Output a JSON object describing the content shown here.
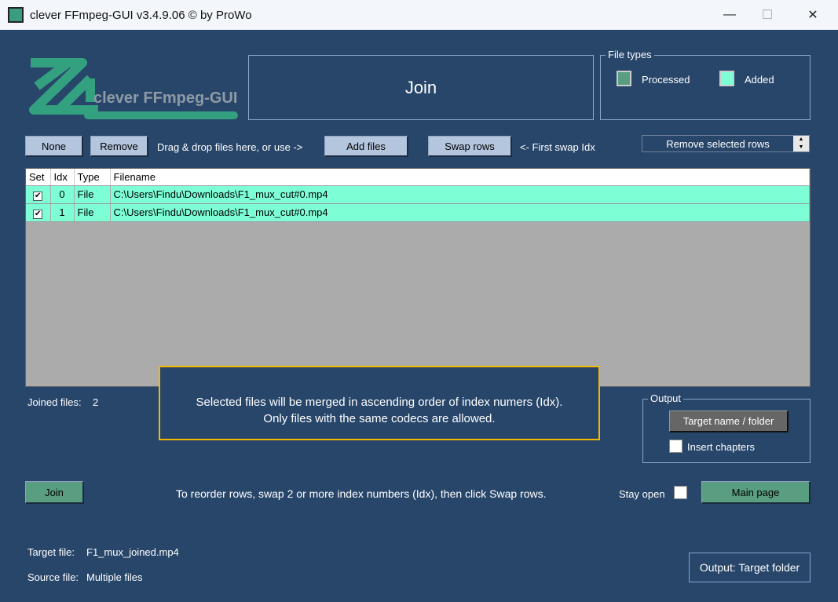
{
  "window": {
    "title": "clever FFmpeg-GUI v3.4.9.06   © by ProWo",
    "minimize": "—",
    "maximize": "☐",
    "close": "✕"
  },
  "logo": {
    "text": "clever FFmpeg-GUI"
  },
  "header": {
    "mode": "Join"
  },
  "file_types": {
    "legend": "File types",
    "processed": "Processed",
    "added": "Added",
    "processed_color": "#5a9e82",
    "added_color": "#7dfed5"
  },
  "toolbar": {
    "none": "None",
    "remove": "Remove",
    "drag_hint": "Drag & drop files here, or use ->",
    "add_files": "Add files",
    "swap_rows": "Swap rows",
    "swap_hint": "<- First swap Idx",
    "remove_selected": "Remove selected rows"
  },
  "table": {
    "headers": [
      "Set",
      "Idx",
      "Type",
      "Filename"
    ],
    "rows": [
      {
        "set": true,
        "idx": "0",
        "type": "File",
        "filename": "C:\\Users\\Findu\\Downloads\\F1_mux_cut#0.mp4"
      },
      {
        "set": true,
        "idx": "1",
        "type": "File",
        "filename": "C:\\Users\\Findu\\Downloads\\F1_mux_cut#0.mp4"
      }
    ]
  },
  "joined": {
    "label": "Joined files:",
    "count": "2"
  },
  "info": {
    "line1": "Selected files will be merged in ascending order of index numers (Idx).",
    "line2": "Only files with the same codecs are allowed."
  },
  "output": {
    "legend": "Output",
    "target_button": "Target name / folder",
    "insert_chapters": "Insert chapters"
  },
  "bottom": {
    "join": "Join",
    "reorder_hint": "To reorder rows, swap 2 or more index numbers  (Idx), then click Swap rows.",
    "stay_open": "Stay open",
    "main_page": "Main page"
  },
  "footer": {
    "target_label": "Target file:",
    "target_value": "F1_mux_joined.mp4",
    "source_label": "Source file:",
    "source_value": "Multiple files",
    "output_button": "Output: Target folder"
  }
}
